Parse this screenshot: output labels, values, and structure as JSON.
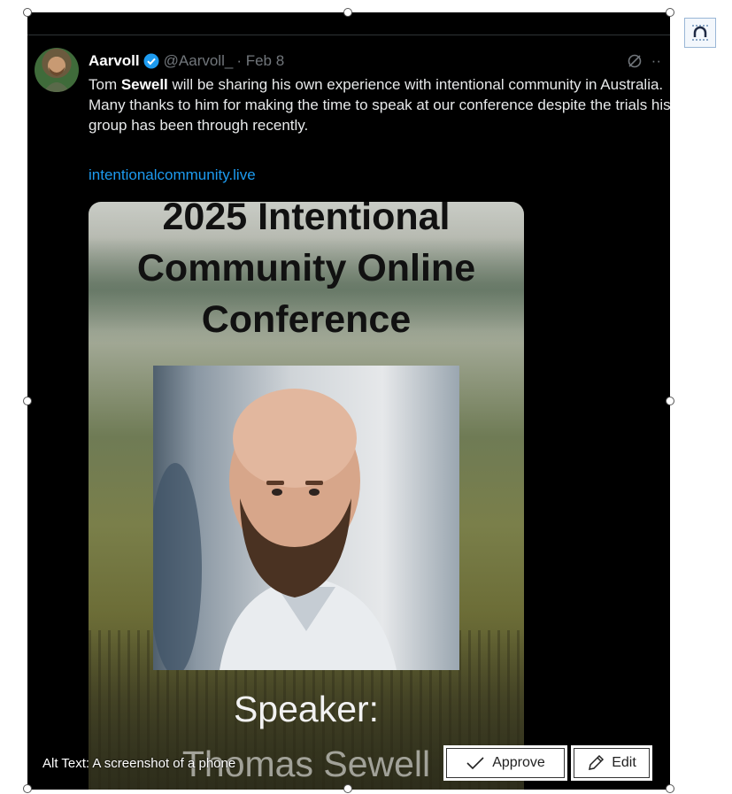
{
  "tweet": {
    "author": "Aarvoll",
    "handle": "@Aarvoll_",
    "date": "· Feb 8",
    "text_pre": "Tom ",
    "text_bold": "Sewell",
    "text_post": " will be sharing his own experience with intentional community in Australia. Many thanks to him for making the time to speak at our conference despite the trials his group has been through recently.",
    "link": "intentionalcommunity.live",
    "more": "··"
  },
  "poster": {
    "title_line1": "2025 Intentional",
    "title_line2": "Community Online",
    "title_line3": "Conference",
    "speaker_label": "Speaker:",
    "speaker_name": "Thomas Sewell"
  },
  "alt_text": {
    "label": "Alt Text: A screenshot of a phone",
    "approve_label": "Approve",
    "edit_label": "Edit"
  },
  "colors": {
    "link": "#1d9bf0",
    "verified": "#1d9bf0",
    "muted": "#71767b"
  },
  "icons": [
    "verified-badge-icon",
    "grok-icon",
    "more-icon",
    "checkmark-icon",
    "pencil-icon",
    "layout-options-icon"
  ]
}
